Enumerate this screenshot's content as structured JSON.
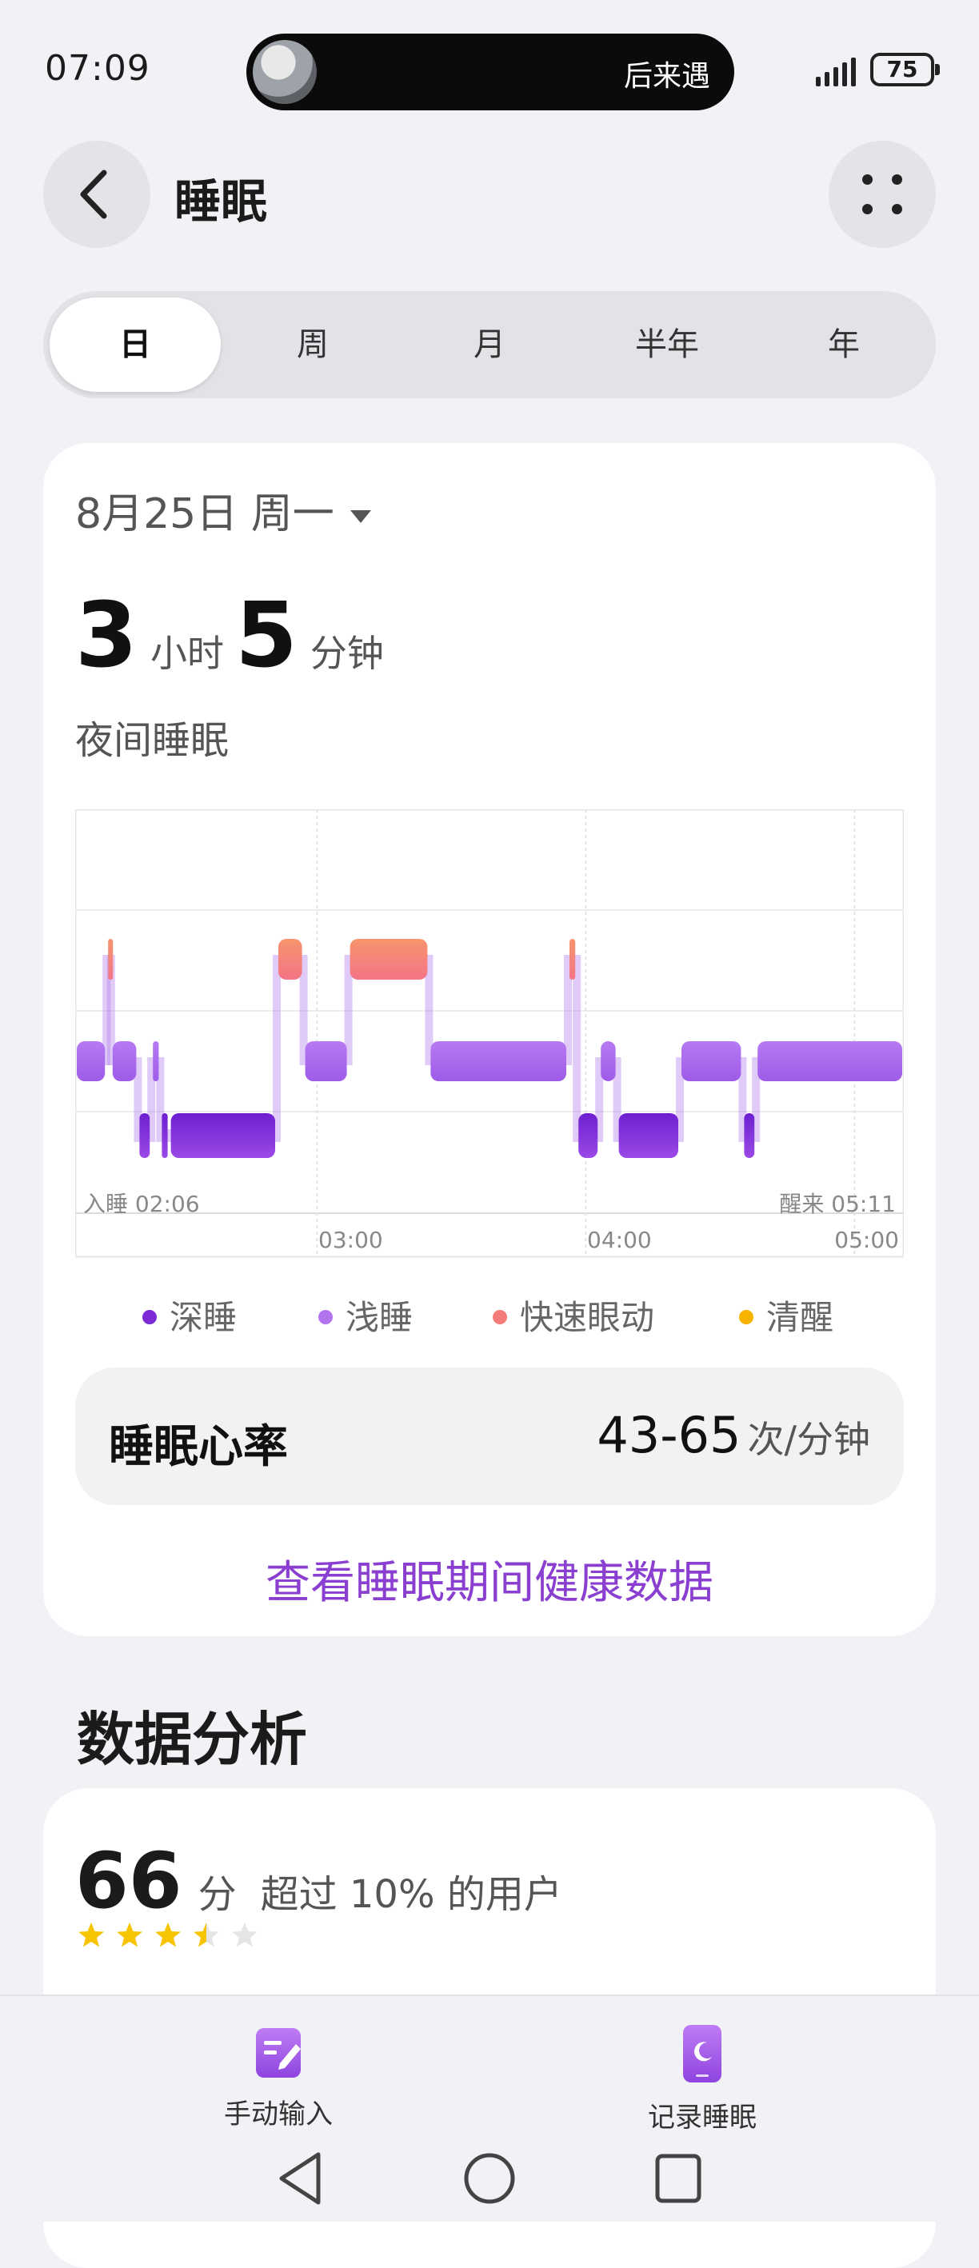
{
  "status_bar": {
    "time": "07:09",
    "now_playing": "后来遇",
    "battery": "75"
  },
  "header": {
    "title": "睡眠"
  },
  "tabs": [
    {
      "label": "日",
      "active": true
    },
    {
      "label": "周",
      "active": false
    },
    {
      "label": "月",
      "active": false
    },
    {
      "label": "半年",
      "active": false
    },
    {
      "label": "年",
      "active": false
    }
  ],
  "summary": {
    "date": "8月25日 周一",
    "hours": "3",
    "hours_unit": "小时",
    "minutes": "5",
    "minutes_unit": "分钟",
    "sleep_type": "夜间睡眠"
  },
  "chart_data": {
    "type": "sleep-stage timeline",
    "x_ticks": [
      "03:00",
      "04:00",
      "05:00"
    ],
    "start_label": "入睡 02:06",
    "end_label": "醒来 05:11",
    "stages": [
      {
        "key": "deep",
        "name": "深睡",
        "color": "#7c2ad6"
      },
      {
        "key": "light",
        "name": "浅睡",
        "color": "#b173ee"
      },
      {
        "key": "rem",
        "name": "快速眼动",
        "color": "#f57b7b"
      },
      {
        "key": "awake",
        "name": "清醒",
        "color": "#f6b400"
      }
    ],
    "segments": [
      {
        "start": "02:06",
        "end": "02:13",
        "stage": "light"
      },
      {
        "start": "02:13",
        "end": "02:14",
        "stage": "rem"
      },
      {
        "start": "02:14",
        "end": "02:20",
        "stage": "light"
      },
      {
        "start": "02:20",
        "end": "02:23",
        "stage": "deep"
      },
      {
        "start": "02:23",
        "end": "02:25",
        "stage": "light"
      },
      {
        "start": "02:25",
        "end": "02:27",
        "stage": "deep"
      },
      {
        "start": "02:27",
        "end": "02:51",
        "stage": "deep"
      },
      {
        "start": "02:51",
        "end": "02:57",
        "stage": "rem"
      },
      {
        "start": "02:57",
        "end": "03:07",
        "stage": "light"
      },
      {
        "start": "03:07",
        "end": "03:25",
        "stage": "rem"
      },
      {
        "start": "03:25",
        "end": "03:56",
        "stage": "light"
      },
      {
        "start": "03:56",
        "end": "03:58",
        "stage": "rem"
      },
      {
        "start": "03:58",
        "end": "04:03",
        "stage": "deep"
      },
      {
        "start": "04:03",
        "end": "04:07",
        "stage": "light"
      },
      {
        "start": "04:07",
        "end": "04:21",
        "stage": "deep"
      },
      {
        "start": "04:21",
        "end": "04:35",
        "stage": "light"
      },
      {
        "start": "04:35",
        "end": "04:38",
        "stage": "deep"
      },
      {
        "start": "04:38",
        "end": "05:11",
        "stage": "light"
      }
    ]
  },
  "heart_rate": {
    "label": "睡眠心率",
    "value": "43-65",
    "unit": "次/分钟"
  },
  "health_link": "查看睡眠期间健康数据",
  "analysis": {
    "title": "数据分析",
    "score": "66",
    "score_unit": "分",
    "score_desc": "超过 10% 的用户",
    "stars": 3.5
  },
  "bottom_actions": {
    "manual": "手动输入",
    "record": "记录睡眠"
  },
  "icons": [
    "back-arrow-icon",
    "more-icon",
    "manual-input-icon",
    "record-sleep-icon",
    "nav-back-icon",
    "nav-home-icon",
    "nav-recents-icon"
  ]
}
